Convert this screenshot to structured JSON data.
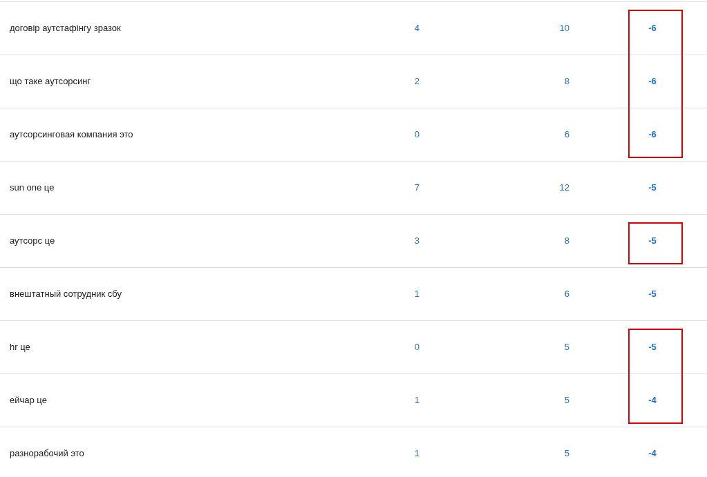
{
  "table": {
    "rows": [
      {
        "query": "договір аутстафінгу зразок",
        "column_2": "4",
        "column_3": "10",
        "change": "-6",
        "highlighted": true
      },
      {
        "query": "що таке аутсорсинг",
        "column_2": "2",
        "column_3": "8",
        "change": "-6",
        "highlighted": true
      },
      {
        "query": "аутсорсинговая компания это",
        "column_2": "0",
        "column_3": "6",
        "change": "-6",
        "highlighted": true
      },
      {
        "query": "sun one це",
        "column_2": "7",
        "column_3": "12",
        "change": "-5",
        "highlighted": false
      },
      {
        "query": "аутсорс це",
        "column_2": "3",
        "column_3": "8",
        "change": "-5",
        "highlighted": true
      },
      {
        "query": "внештатный сотрудник сбу",
        "column_2": "1",
        "column_3": "6",
        "change": "-5",
        "highlighted": false
      },
      {
        "query": "hr це",
        "column_2": "0",
        "column_3": "5",
        "change": "-5",
        "highlighted": true
      },
      {
        "query": "ейчар це",
        "column_2": "1",
        "column_3": "5",
        "change": "-4",
        "highlighted": true
      },
      {
        "query": "разнорабочий это",
        "column_2": "1",
        "column_3": "5",
        "change": "-4",
        "highlighted": false
      }
    ]
  }
}
